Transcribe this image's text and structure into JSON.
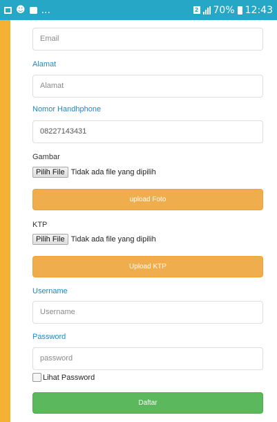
{
  "status_bar": {
    "battery": "70%",
    "time": "12:43",
    "sim_label": "2",
    "overflow": "..."
  },
  "form": {
    "email_placeholder": "Email",
    "alamat_label": "Alamat",
    "alamat_placeholder": "Alamat",
    "phone_label": "Nomor Handhphone",
    "phone_value": "08227143431",
    "gambar_label": "Gambar",
    "gambar_file_button": "Pilih File",
    "gambar_file_status": "Tidak ada file yang dipilih",
    "upload_foto_label": "upload Foto",
    "ktp_label": "KTP",
    "ktp_file_button": "Pilih File",
    "ktp_file_status": "Tidak ada file yang dipilih",
    "upload_ktp_label": "Upload KTP",
    "username_label": "Username",
    "username_placeholder": "Username",
    "password_label": "Password",
    "password_placeholder": "password",
    "show_password_label": "Lihat Password",
    "submit_label": "Daftar"
  },
  "colors": {
    "status_bar": "#27a7c6",
    "accent_stripe": "#f5b133",
    "label_blue": "#1e88c8",
    "upload_button": "#f0ad4e",
    "submit_button": "#5cb85c"
  }
}
